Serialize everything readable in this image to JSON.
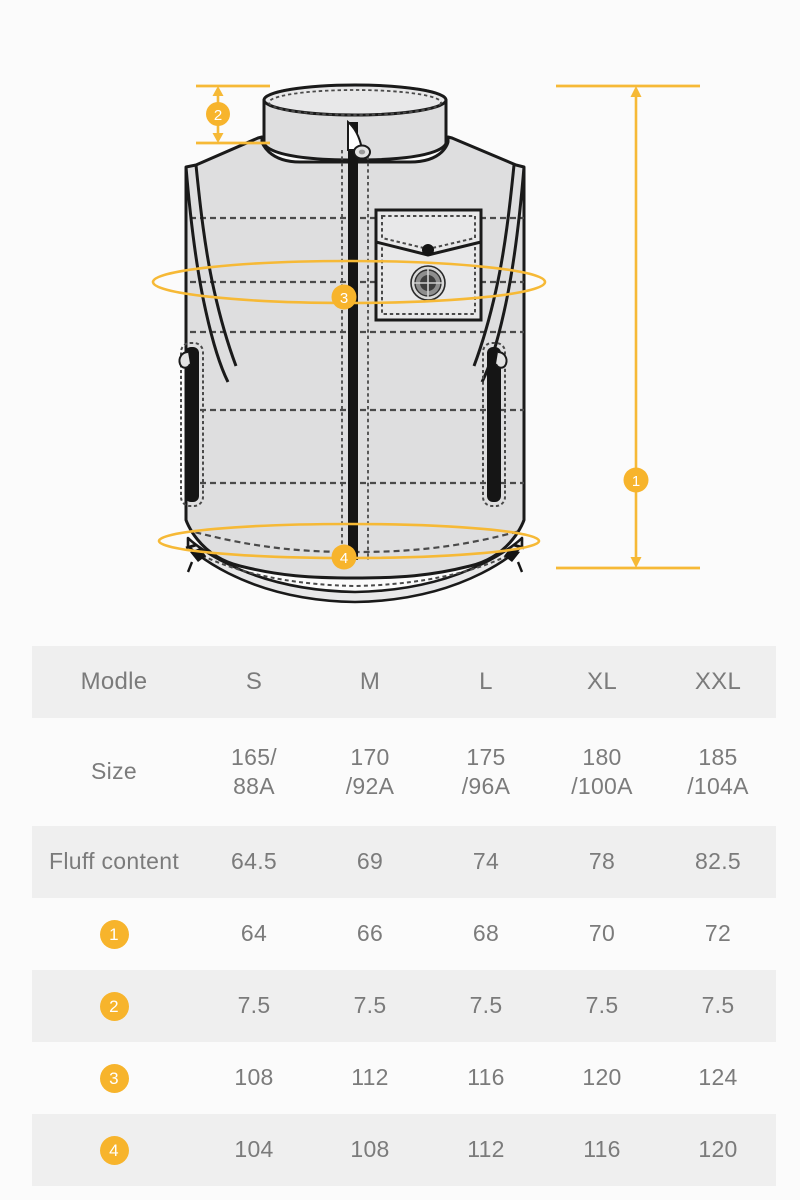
{
  "product": {
    "type": "quilted-vest-technical-drawing",
    "view": "front",
    "description": "Sleeveless stand-collar quilted down vest with center front zipper, flap chest pocket with snap and round emblem, two vertical zippered side pockets, horizontal quilt channels and drawcord hem toggles"
  },
  "colors": {
    "accent": "#f7b42c",
    "accent_line": "#f6b936",
    "garment_fill": "#dededf",
    "garment_fill_light": "#e8e8e9",
    "outline": "#1a1a1a",
    "stitch": "#4a4a4a",
    "background": "#fbfbfb",
    "row_shaded": "#efefef",
    "row_plain": "#fbfbfb",
    "text": "#7b7b7b"
  },
  "measurement_markers": [
    {
      "id": "1",
      "label": "1",
      "measures": "garment-length",
      "placement": "right-vertical-dimension-arrow"
    },
    {
      "id": "2",
      "label": "2",
      "measures": "collar-height",
      "placement": "top-left-vertical-dimension-arrow"
    },
    {
      "id": "3",
      "label": "3",
      "measures": "chest-circumference",
      "placement": "chest-ellipse-ring"
    },
    {
      "id": "4",
      "label": "4",
      "measures": "hem-circumference",
      "placement": "hem-ellipse-ring"
    }
  ],
  "table": {
    "header": {
      "label": "Modle",
      "sizes": [
        "S",
        "M",
        "L",
        "XL",
        "XXL"
      ]
    },
    "rows": [
      {
        "label": "Size",
        "type": "size",
        "values": [
          {
            "line1": "165/",
            "line2": "88A"
          },
          {
            "line1": "170",
            "line2": "/92A"
          },
          {
            "line1": "175",
            "line2": "/96A"
          },
          {
            "line1": "180",
            "line2": "/100A"
          },
          {
            "line1": "185",
            "line2": "/104A"
          }
        ]
      },
      {
        "label": "Fluff content",
        "type": "text",
        "values": [
          "64.5",
          "69",
          "74",
          "78",
          "82.5"
        ]
      },
      {
        "label": "1",
        "type": "badge",
        "values": [
          "64",
          "66",
          "68",
          "70",
          "72"
        ]
      },
      {
        "label": "2",
        "type": "badge",
        "values": [
          "7.5",
          "7.5",
          "7.5",
          "7.5",
          "7.5"
        ]
      },
      {
        "label": "3",
        "type": "badge",
        "values": [
          "108",
          "112",
          "116",
          "120",
          "124"
        ]
      },
      {
        "label": "4",
        "type": "badge",
        "values": [
          "104",
          "108",
          "112",
          "116",
          "120"
        ]
      }
    ]
  }
}
